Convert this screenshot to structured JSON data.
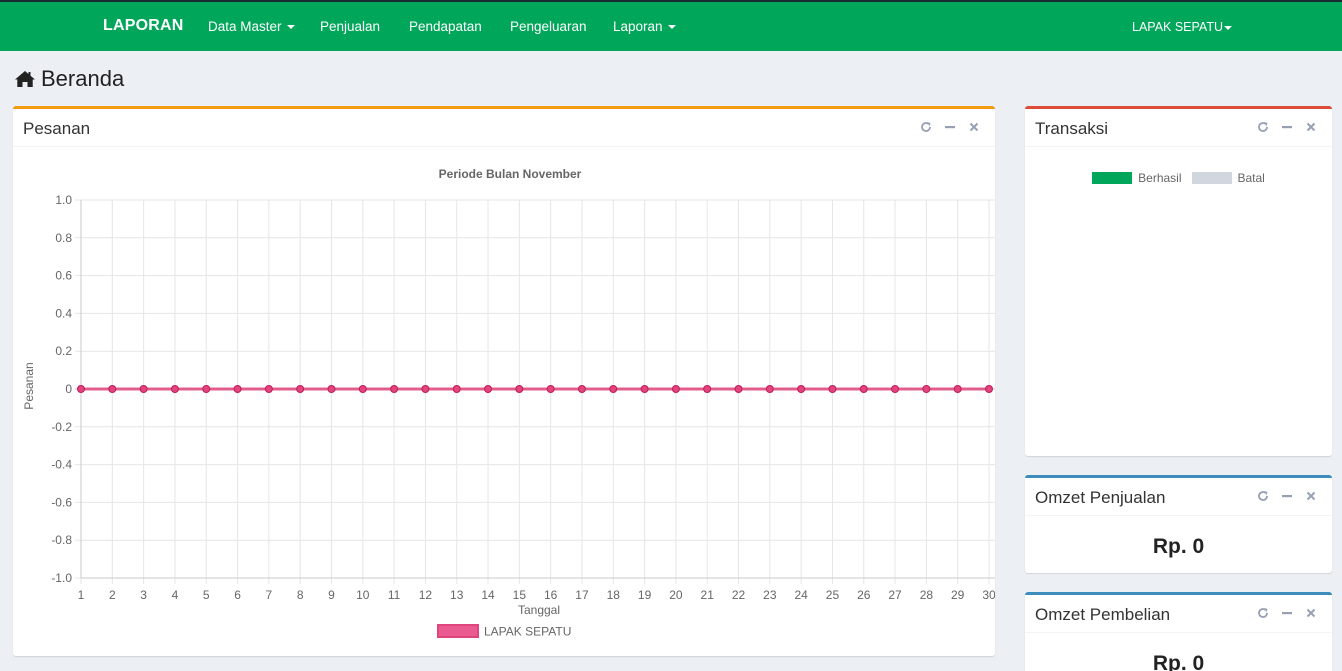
{
  "navbar": {
    "brand": "LAPORAN",
    "items": [
      {
        "label": "Data Master",
        "dropdown": true
      },
      {
        "label": "Penjualan",
        "dropdown": false
      },
      {
        "label": "Pendapatan",
        "dropdown": false
      },
      {
        "label": "Pengeluaran",
        "dropdown": false
      },
      {
        "label": "Laporan",
        "dropdown": true
      }
    ],
    "user": "LAPAK SEPATU",
    "color": "#00a65a"
  },
  "page": {
    "title": "Beranda",
    "icon": "home-icon"
  },
  "pesanan": {
    "title": "Pesanan",
    "accent": "#f39c12"
  },
  "transaksi": {
    "title": "Transaksi",
    "accent": "#dd4b39",
    "legend": [
      {
        "label": "Berhasil",
        "color": "#00a65a"
      },
      {
        "label": "Batal",
        "color": "#d2d6de"
      }
    ]
  },
  "omzet_penjualan": {
    "title": "Omzet Penjualan",
    "value": "Rp. 0",
    "accent": "#3c8dbc"
  },
  "omzet_pembelian": {
    "title": "Omzet Pembelian",
    "value": "Rp. 0",
    "accent": "#3c8dbc"
  },
  "tools": [
    "refresh-icon",
    "minimize-icon",
    "close-icon"
  ],
  "chart_data": {
    "type": "line",
    "title": "Periode Bulan November",
    "xlabel": "Tanggal",
    "ylabel": "Pesanan",
    "x": [
      1,
      2,
      3,
      4,
      5,
      6,
      7,
      8,
      9,
      10,
      11,
      12,
      13,
      14,
      15,
      16,
      17,
      18,
      19,
      20,
      21,
      22,
      23,
      24,
      25,
      26,
      27,
      28,
      29,
      30
    ],
    "ylim": [
      -1.0,
      1.0
    ],
    "yticks": [
      "1.0",
      "0.8",
      "0.6",
      "0.4",
      "0.2",
      "0",
      "-0.2",
      "-0.4",
      "-0.6",
      "-0.8",
      "-1.0"
    ],
    "grid": true,
    "legend_position": "bottom",
    "series": [
      {
        "name": "LAPAK SEPATU",
        "color": "#e0457b",
        "values": [
          0,
          0,
          0,
          0,
          0,
          0,
          0,
          0,
          0,
          0,
          0,
          0,
          0,
          0,
          0,
          0,
          0,
          0,
          0,
          0,
          0,
          0,
          0,
          0,
          0,
          0,
          0,
          0,
          0,
          0
        ]
      }
    ]
  }
}
